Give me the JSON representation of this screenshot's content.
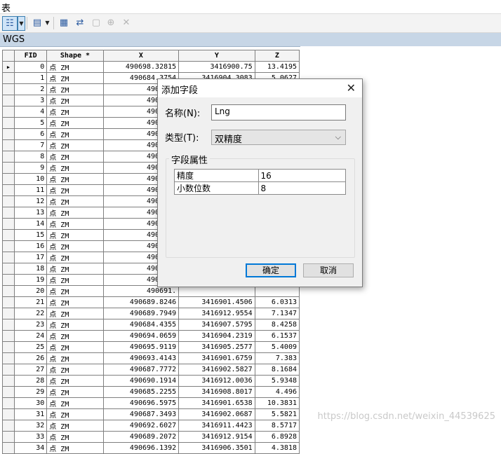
{
  "window": {
    "title": "表"
  },
  "tab": {
    "label": "WGS"
  },
  "grid": {
    "columns": [
      "FID",
      "Shape *",
      "X",
      "Y",
      "Z"
    ],
    "rows": [
      [
        "0",
        "点 ZM",
        "490698.32815",
        "3416900.75",
        "13.4195"
      ],
      [
        "1",
        "点 ZM",
        "490684.3754",
        "3416904.3083",
        "5.0627"
      ],
      [
        "2",
        "点 ZM",
        "490685.",
        "",
        ""
      ],
      [
        "3",
        "点 ZM",
        "490684.",
        "",
        ""
      ],
      [
        "4",
        "点 ZM",
        "490690.",
        "",
        ""
      ],
      [
        "5",
        "点 ZM",
        "490685.",
        "",
        ""
      ],
      [
        "6",
        "点 ZM",
        "490692.",
        "",
        ""
      ],
      [
        "7",
        "点 ZM",
        "490692.",
        "",
        ""
      ],
      [
        "8",
        "点 ZM",
        "490687.",
        "",
        ""
      ],
      [
        "9",
        "点 ZM",
        "490684.",
        "",
        ""
      ],
      [
        "10",
        "点 ZM",
        "490685.",
        "",
        ""
      ],
      [
        "11",
        "点 ZM",
        "490684.",
        "",
        ""
      ],
      [
        "12",
        "点 ZM",
        "490686.",
        "",
        ""
      ],
      [
        "13",
        "点 ZM",
        "490697.",
        "",
        ""
      ],
      [
        "14",
        "点 ZM",
        "490692.",
        "",
        ""
      ],
      [
        "15",
        "点 ZM",
        "490692.",
        "",
        ""
      ],
      [
        "16",
        "点 ZM",
        "490691.",
        "",
        ""
      ],
      [
        "17",
        "点 ZM",
        "490688.",
        "",
        ""
      ],
      [
        "18",
        "点 ZM",
        "490697.",
        "",
        ""
      ],
      [
        "19",
        "点 ZM",
        "490687.",
        "",
        ""
      ],
      [
        "20",
        "点 ZM",
        "490691.",
        "",
        ""
      ],
      [
        "21",
        "点 ZM",
        "490689.8246",
        "3416901.4506",
        "6.0313"
      ],
      [
        "22",
        "点 ZM",
        "490689.7949",
        "3416912.9554",
        "7.1347"
      ],
      [
        "23",
        "点 ZM",
        "490684.4355",
        "3416907.5795",
        "8.4258"
      ],
      [
        "24",
        "点 ZM",
        "490694.0659",
        "3416904.2319",
        "6.1537"
      ],
      [
        "25",
        "点 ZM",
        "490695.9119",
        "3416905.2577",
        "5.4009"
      ],
      [
        "26",
        "点 ZM",
        "490693.4143",
        "3416901.6759",
        "7.383"
      ],
      [
        "27",
        "点 ZM",
        "490687.7772",
        "3416902.5827",
        "8.1684"
      ],
      [
        "28",
        "点 ZM",
        "490690.1914",
        "3416912.0036",
        "5.9348"
      ],
      [
        "29",
        "点 ZM",
        "490685.2255",
        "3416908.8017",
        "4.496"
      ],
      [
        "30",
        "点 ZM",
        "490696.5975",
        "3416901.6538",
        "10.3831"
      ],
      [
        "31",
        "点 ZM",
        "490687.3493",
        "3416902.0687",
        "5.5821"
      ],
      [
        "32",
        "点 ZM",
        "490692.6027",
        "3416911.4423",
        "8.5717"
      ],
      [
        "33",
        "点 ZM",
        "490689.2072",
        "3416912.9154",
        "6.8928"
      ],
      [
        "34",
        "点 ZM",
        "490696.1392",
        "3416906.3501",
        "4.3818"
      ]
    ]
  },
  "dialog": {
    "title": "添加字段",
    "close_icon": "close-icon",
    "name_label": "名称(N):",
    "name_value": "Lng",
    "type_label": "类型(T):",
    "type_value": "双精度",
    "group_label": "字段属性",
    "properties": [
      {
        "key": "精度",
        "value": "16"
      },
      {
        "key": "小数位数",
        "value": "8"
      }
    ],
    "ok_label": "确定",
    "cancel_label": "取消"
  },
  "watermark": "https://blog.csdn.net/weixin_44539625"
}
